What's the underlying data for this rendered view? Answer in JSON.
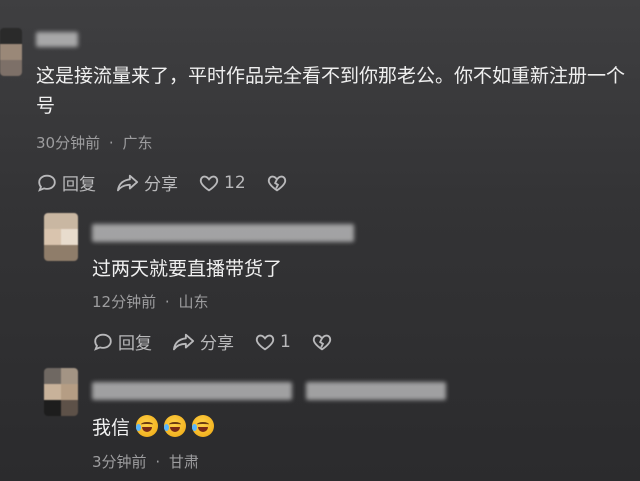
{
  "comments": [
    {
      "text": "这是接流量来了，平时作品完全看不到你那老公。你不如重新注册一个号",
      "time": "30分钟前",
      "sep": "·",
      "location": "广东",
      "reply_label": "回复",
      "share_label": "分享",
      "like_count": "12"
    },
    {
      "text": "过两天就要直播带货了",
      "time": "12分钟前",
      "sep": "·",
      "location": "山东",
      "reply_label": "回复",
      "share_label": "分享",
      "like_count": "1"
    },
    {
      "text": "我信",
      "emojis": [
        "laughing-crying-emoji",
        "laughing-crying-emoji",
        "laughing-crying-emoji"
      ],
      "time": "3分钟前",
      "sep": "·",
      "location": "甘肃"
    }
  ],
  "icons": {
    "reply": "reply-bubble-icon",
    "share": "share-arrow-icon",
    "like": "heart-icon",
    "dislike": "broken-heart-icon"
  },
  "colors": {
    "background": "#363638",
    "text": "#f0f0f0",
    "meta": "#9d9d9f",
    "action": "#b9b9bb"
  }
}
